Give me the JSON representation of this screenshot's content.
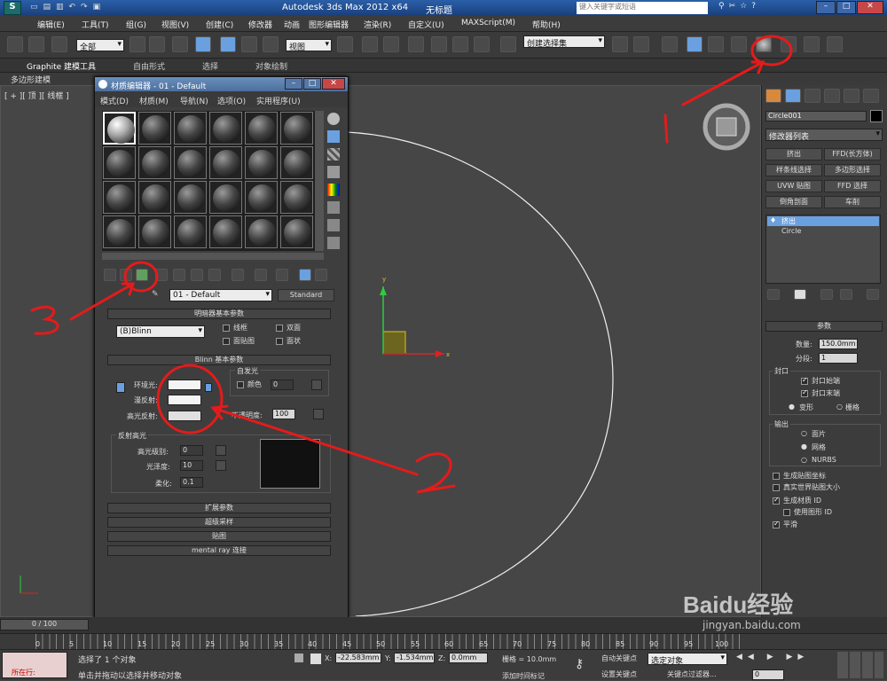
{
  "app": {
    "title": "Autodesk 3ds Max  2012 x64",
    "doc": "无标题",
    "search_placeholder": "键入关键字或短语"
  },
  "menu": [
    "编辑(E)",
    "工具(T)",
    "组(G)",
    "视图(V)",
    "创建(C)",
    "修改器",
    "动画",
    "图形编辑器",
    "渲染(R)",
    "自定义(U)",
    "MAXScript(M)",
    "帮助(H)"
  ],
  "toolbar": {
    "filter": "全部",
    "view": "视图",
    "selection_set": "创建选择集"
  },
  "ribbon": {
    "tabs": [
      "Graphite 建模工具",
      "自由形式",
      "选择",
      "对象绘制"
    ],
    "sub": "多边形建模"
  },
  "viewport": {
    "label": "[ + ][ 顶 ][ 线框 ]"
  },
  "mat": {
    "title": "材质编辑器 - 01 - Default",
    "menu": [
      "模式(D)",
      "材质(M)",
      "导航(N)",
      "选项(O)",
      "实用程序(U)"
    ],
    "name": "01 - Default",
    "type": "Standard",
    "shader_rollout": "明暗器基本参数",
    "shader": "(B)Blinn",
    "shader_opts": [
      "线框",
      "双面",
      "面贴图",
      "面状"
    ],
    "blinn_rollout": "Blinn 基本参数",
    "ambient": "环境光:",
    "diffuse": "漫反射:",
    "specular": "高光反射:",
    "self_illum": "自发光",
    "color": "颜色",
    "color_val": "0",
    "opacity": "不透明度:",
    "opacity_val": "100",
    "spec_hl": "反射高光",
    "spec_level": "高光级别:",
    "spec_level_val": "0",
    "gloss": "光泽度:",
    "gloss_val": "10",
    "soften": "柔化:",
    "soften_val": "0.1",
    "rollouts": [
      "扩展参数",
      "超级采样",
      "贴图",
      "mental ray 连接"
    ]
  },
  "cmd": {
    "object_name": "Circle001",
    "modlist": "修改器列表",
    "buttons": [
      "挤出",
      "FFD(长方体)",
      "样条线选择",
      "多边形选择",
      "UVW 贴图",
      "FFD 选择",
      "倒角剖面",
      "车削"
    ],
    "stack": [
      "挤出",
      "Circle"
    ],
    "params": "参数",
    "amount": "数量:",
    "amount_val": "150.0mm",
    "segments": "分段:",
    "segments_val": "1",
    "cap": "封口",
    "cap_start": "封口始端",
    "cap_end": "封口末端",
    "morph": "变形",
    "grid": "栅格",
    "output": "输出",
    "patch": "面片",
    "mesh": "网格",
    "nurbs": "NURBS",
    "gen_map": "生成贴图坐标",
    "real_world": "真实世界贴图大小",
    "gen_mat": "生成材质 ID",
    "use_shape": "使用图形 ID",
    "smooth": "平滑"
  },
  "timeline": {
    "frame": "0 / 100",
    "ticks": [
      "0",
      "5",
      "10",
      "15",
      "20",
      "25",
      "30",
      "35",
      "40",
      "45",
      "50",
      "55",
      "60",
      "65",
      "70",
      "75",
      "80",
      "85",
      "90",
      "95",
      "100"
    ]
  },
  "status": {
    "msg1": "选择了 1 个对象",
    "msg2": "单击并拖动以选择并移动对象",
    "x": "-22.583mm",
    "y": "-1.534mm",
    "z": "0.0mm",
    "grid": "栅格 = 10.0mm",
    "auto_key": "自动关键点",
    "set_key": "设置关键点",
    "selected": "选定对象",
    "key_filter": "关键点过滤器...",
    "add_time": "添加时间标记",
    "running": "所在行:",
    "frame": "0"
  },
  "annotations": [
    "1",
    "2",
    "3"
  ],
  "watermark": {
    "brand": "Baidu经验",
    "url": "jingyan.baidu.com"
  }
}
